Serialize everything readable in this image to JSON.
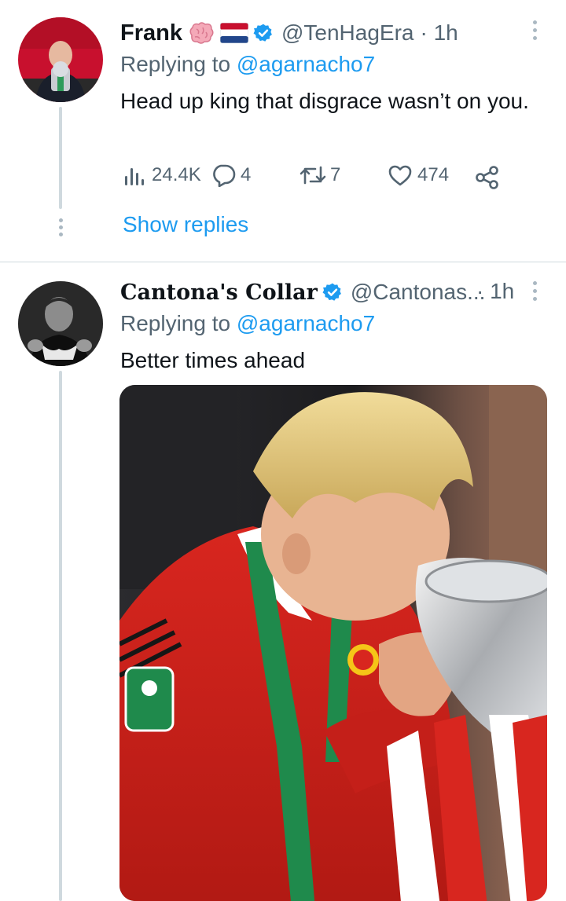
{
  "tweets": [
    {
      "display_name": "Frank",
      "handle": "@TenHagEra",
      "time": "· 1h",
      "replying_prefix": "Replying to",
      "replying_handle": "@agarnacho7",
      "text": "Head up king that disgrace wasn’t on you.",
      "stats": {
        "views": "24.4K",
        "replies": "4",
        "retweets": "7",
        "likes": "474"
      },
      "show_replies": "Show replies"
    },
    {
      "display_name": "Cantona's Collar",
      "handle": "@Cantonas...",
      "time": "· 1h",
      "replying_prefix": "Replying to",
      "replying_handle": "@agarnacho7",
      "text": "Better times ahead"
    }
  ],
  "colors": {
    "accent": "#1d9bf0",
    "secondary_text": "#536471",
    "verified": "#1d9bf0",
    "thread_line": "#cfd9de"
  },
  "icons": [
    "brain-emoji-icon",
    "netherlands-flag-icon",
    "verified-badge-icon",
    "more-options-icon",
    "views-icon",
    "reply-icon",
    "retweet-icon",
    "like-icon",
    "share-icon"
  ]
}
